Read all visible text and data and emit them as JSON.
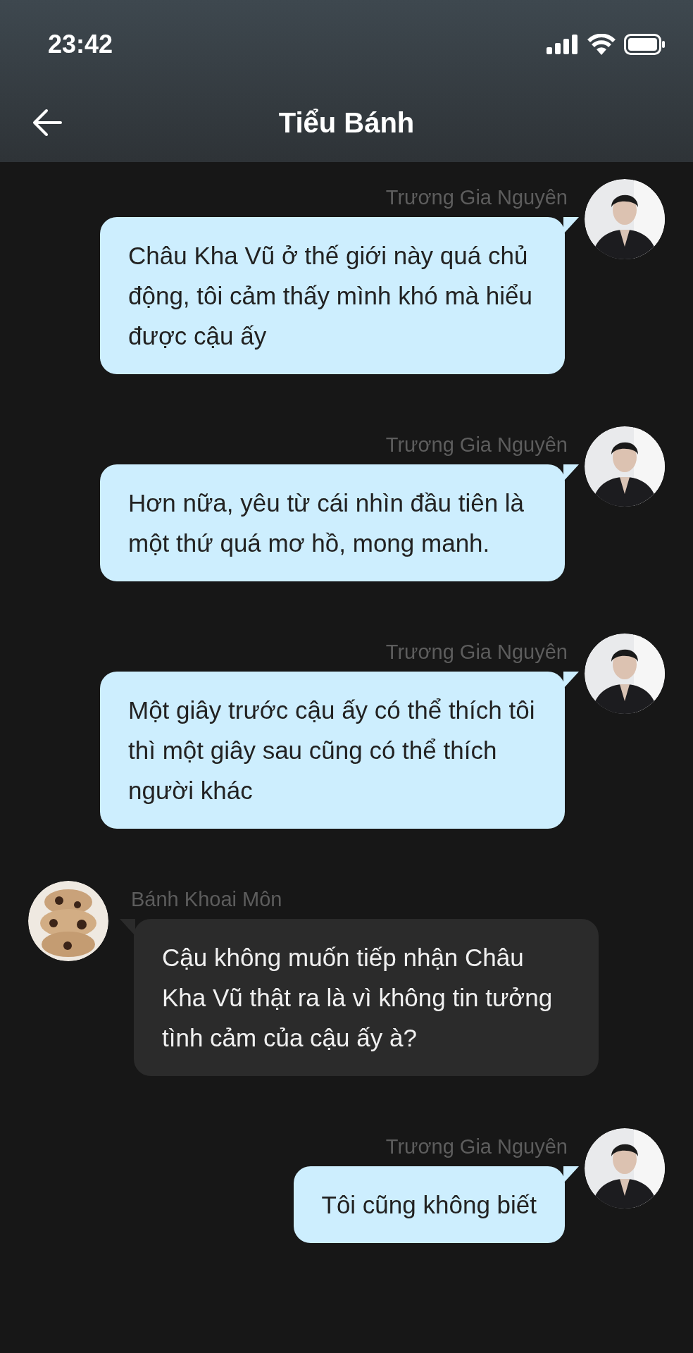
{
  "status_bar": {
    "time": "23:42"
  },
  "header": {
    "title": "Tiểu Bánh"
  },
  "messages": [
    {
      "kind": "outgoing",
      "sender": "Trương Gia Nguyên",
      "text": "Châu Kha Vũ ở thế giới này quá chủ động, tôi cảm thấy mình khó mà hiểu được cậu ấy"
    },
    {
      "kind": "outgoing",
      "sender": "Trương Gia Nguyên",
      "text": "Hơn nữa, yêu từ cái nhìn đầu tiên là một thứ quá mơ hồ, mong manh."
    },
    {
      "kind": "outgoing",
      "sender": "Trương Gia Nguyên",
      "text": "Một giây trước cậu ấy có thể thích tôi thì một giây sau cũng có thể thích người khác"
    },
    {
      "kind": "incoming",
      "sender": "Bánh Khoai Môn",
      "text": "Cậu không muốn tiếp nhận Châu Kha Vũ thật ra là vì không tin tưởng tình cảm của cậu ấy à?"
    },
    {
      "kind": "outgoing",
      "sender": "Trương Gia Nguyên",
      "text": "Tôi cũng không biết"
    }
  ]
}
